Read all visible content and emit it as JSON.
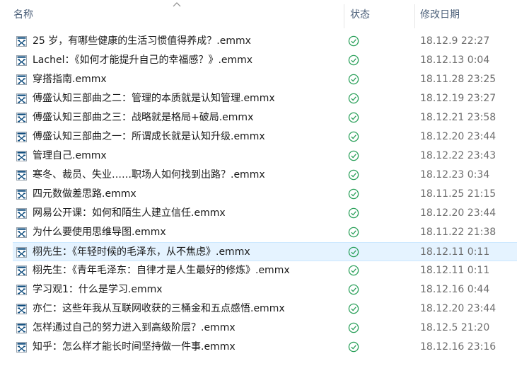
{
  "header": {
    "name_label": "名称",
    "status_label": "状态",
    "date_label": "修改日期",
    "sort_icon": "chevron-up-icon"
  },
  "icons": {
    "file": "xmind-file-icon",
    "status": "synced-check-icon",
    "status_color": "#2aa05a",
    "file_icon_color": "#0b4a7c"
  },
  "selected_row": 11,
  "files": [
    {
      "name": "25 岁，有哪些健康的生活习惯值得养成？.emmx",
      "date": "18.12.9 22:27"
    },
    {
      "name": "Lachel：《如何才能提升自己的幸福感？》.emmx",
      "date": "18.12.13 0:04"
    },
    {
      "name": "穿搭指南.emmx",
      "date": "18.11.28 23:25"
    },
    {
      "name": "傅盛认知三部曲之二：管理的本质就是认知管理.emmx",
      "date": "18.12.19 23:27"
    },
    {
      "name": "傅盛认知三部曲之三：战略就是格局+破局.emmx",
      "date": "18.12.21 23:58"
    },
    {
      "name": "傅盛认知三部曲之一：所谓成长就是认知升级.emmx",
      "date": "18.12.20 23:44"
    },
    {
      "name": "管理自己.emmx",
      "date": "18.12.22 23:43"
    },
    {
      "name": "寒冬、裁员、失业……职场人如何找到出路？.emmx",
      "date": "18.12.23 0:34"
    },
    {
      "name": "四元数做差思路.emmx",
      "date": "18.11.25 21:15"
    },
    {
      "name": "网易公开课：如何和陌生人建立信任.emmx",
      "date": "18.12.20 23:44"
    },
    {
      "name": "为什么要使用思维导图.emmx",
      "date": "18.11.22 21:38"
    },
    {
      "name": "栩先生：《年轻时候的毛泽东，从不焦虑》.emmx",
      "date": "18.12.11 0:11"
    },
    {
      "name": "栩先生：《青年毛泽东：自律才是人生最好的修炼》.emmx",
      "date": "18.12.11 0:11"
    },
    {
      "name": "学习观1：什么是学习.emmx",
      "date": "18.12.16 0:44"
    },
    {
      "name": "亦仁：这些年我从互联网收获的三桶金和五点感悟.emmx",
      "date": "18.12.20 23:44"
    },
    {
      "name": "怎样通过自己的努力进入到高级阶层？.emmx",
      "date": "18.12.5 21:20"
    },
    {
      "name": "知乎：怎么样才能长时间坚持做一件事.emmx",
      "date": "18.12.16 23:16"
    }
  ]
}
